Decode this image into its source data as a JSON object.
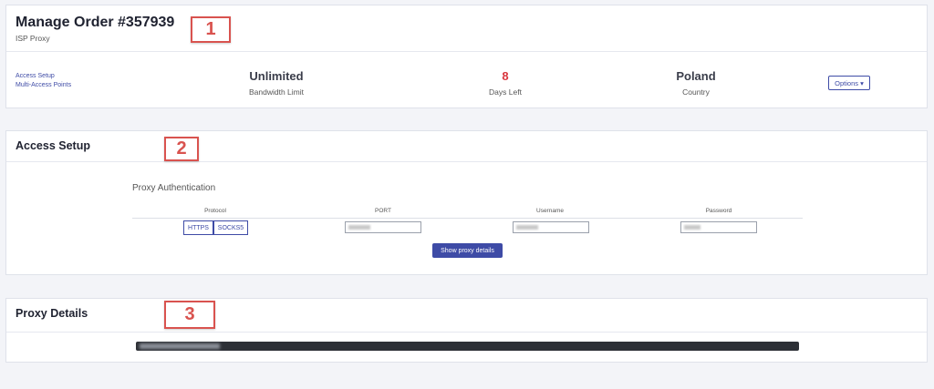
{
  "order": {
    "title": "Manage Order #357939",
    "subtitle": "ISP Proxy",
    "links": [
      "Access Setup",
      "Multi-Access Points"
    ],
    "stats": [
      {
        "value": "Unlimited",
        "label": "Bandwidth Limit"
      },
      {
        "value": "8",
        "label": "Days Left",
        "color": "#d9373f"
      },
      {
        "value": "Poland",
        "label": "Country"
      }
    ],
    "options_label": "Options ▾"
  },
  "access": {
    "title": "Access Setup",
    "section_label": "Proxy Authentication",
    "headers": [
      "Protocol",
      "PORT",
      "Username",
      "Password"
    ],
    "protocols": [
      "HTTPS",
      "SOCKS5"
    ],
    "show_details_label": "Show proxy details"
  },
  "details": {
    "title": "Proxy Details"
  },
  "markers": [
    "1",
    "2",
    "3"
  ],
  "colors": {
    "accent": "#3e4ba6",
    "marker": "#d9534f",
    "days_left": "#d9373f",
    "background": "#f3f4f8"
  }
}
